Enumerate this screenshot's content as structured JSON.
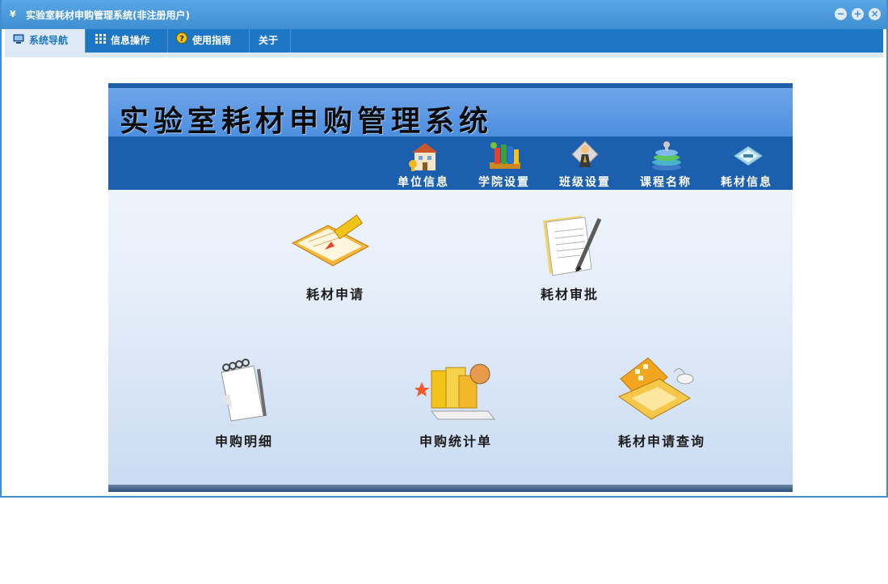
{
  "window": {
    "title": "实验室耗材申购管理系统(非注册用户)",
    "app_icon_text": "¥"
  },
  "tabs": [
    {
      "label": "系统导航",
      "icon": "monitor-icon",
      "active": true
    },
    {
      "label": "信息操作",
      "icon": "grid-icon",
      "active": false
    },
    {
      "label": "使用指南",
      "icon": "help-icon",
      "active": false
    },
    {
      "label": "关于",
      "icon": "",
      "active": false
    }
  ],
  "banner": {
    "title": "实验室耗材申购管理系统"
  },
  "nav_items": [
    {
      "label": "单位信息",
      "icon": "building-icon"
    },
    {
      "label": "学院设置",
      "icon": "books-shelf-icon"
    },
    {
      "label": "班级设置",
      "icon": "person-award-icon"
    },
    {
      "label": "课程名称",
      "icon": "book-stack-icon"
    },
    {
      "label": "耗材信息",
      "icon": "card-icon"
    }
  ],
  "functions": {
    "apply": {
      "label": "耗材申请",
      "icon": "notebook-pencil-icon"
    },
    "approve": {
      "label": "耗材审批",
      "icon": "document-pen-icon"
    },
    "details": {
      "label": "申购明细",
      "icon": "spiral-notepad-icon"
    },
    "stats": {
      "label": "申购统计单",
      "icon": "folders-globe-icon"
    },
    "query": {
      "label": "耗材申请查询",
      "icon": "laptop-mouse-icon"
    }
  },
  "colors": {
    "titlebar": "#3f8fd2",
    "tabbar": "#1d77c4",
    "navbar": "#1b5fae",
    "banner": "#5c99e4"
  }
}
